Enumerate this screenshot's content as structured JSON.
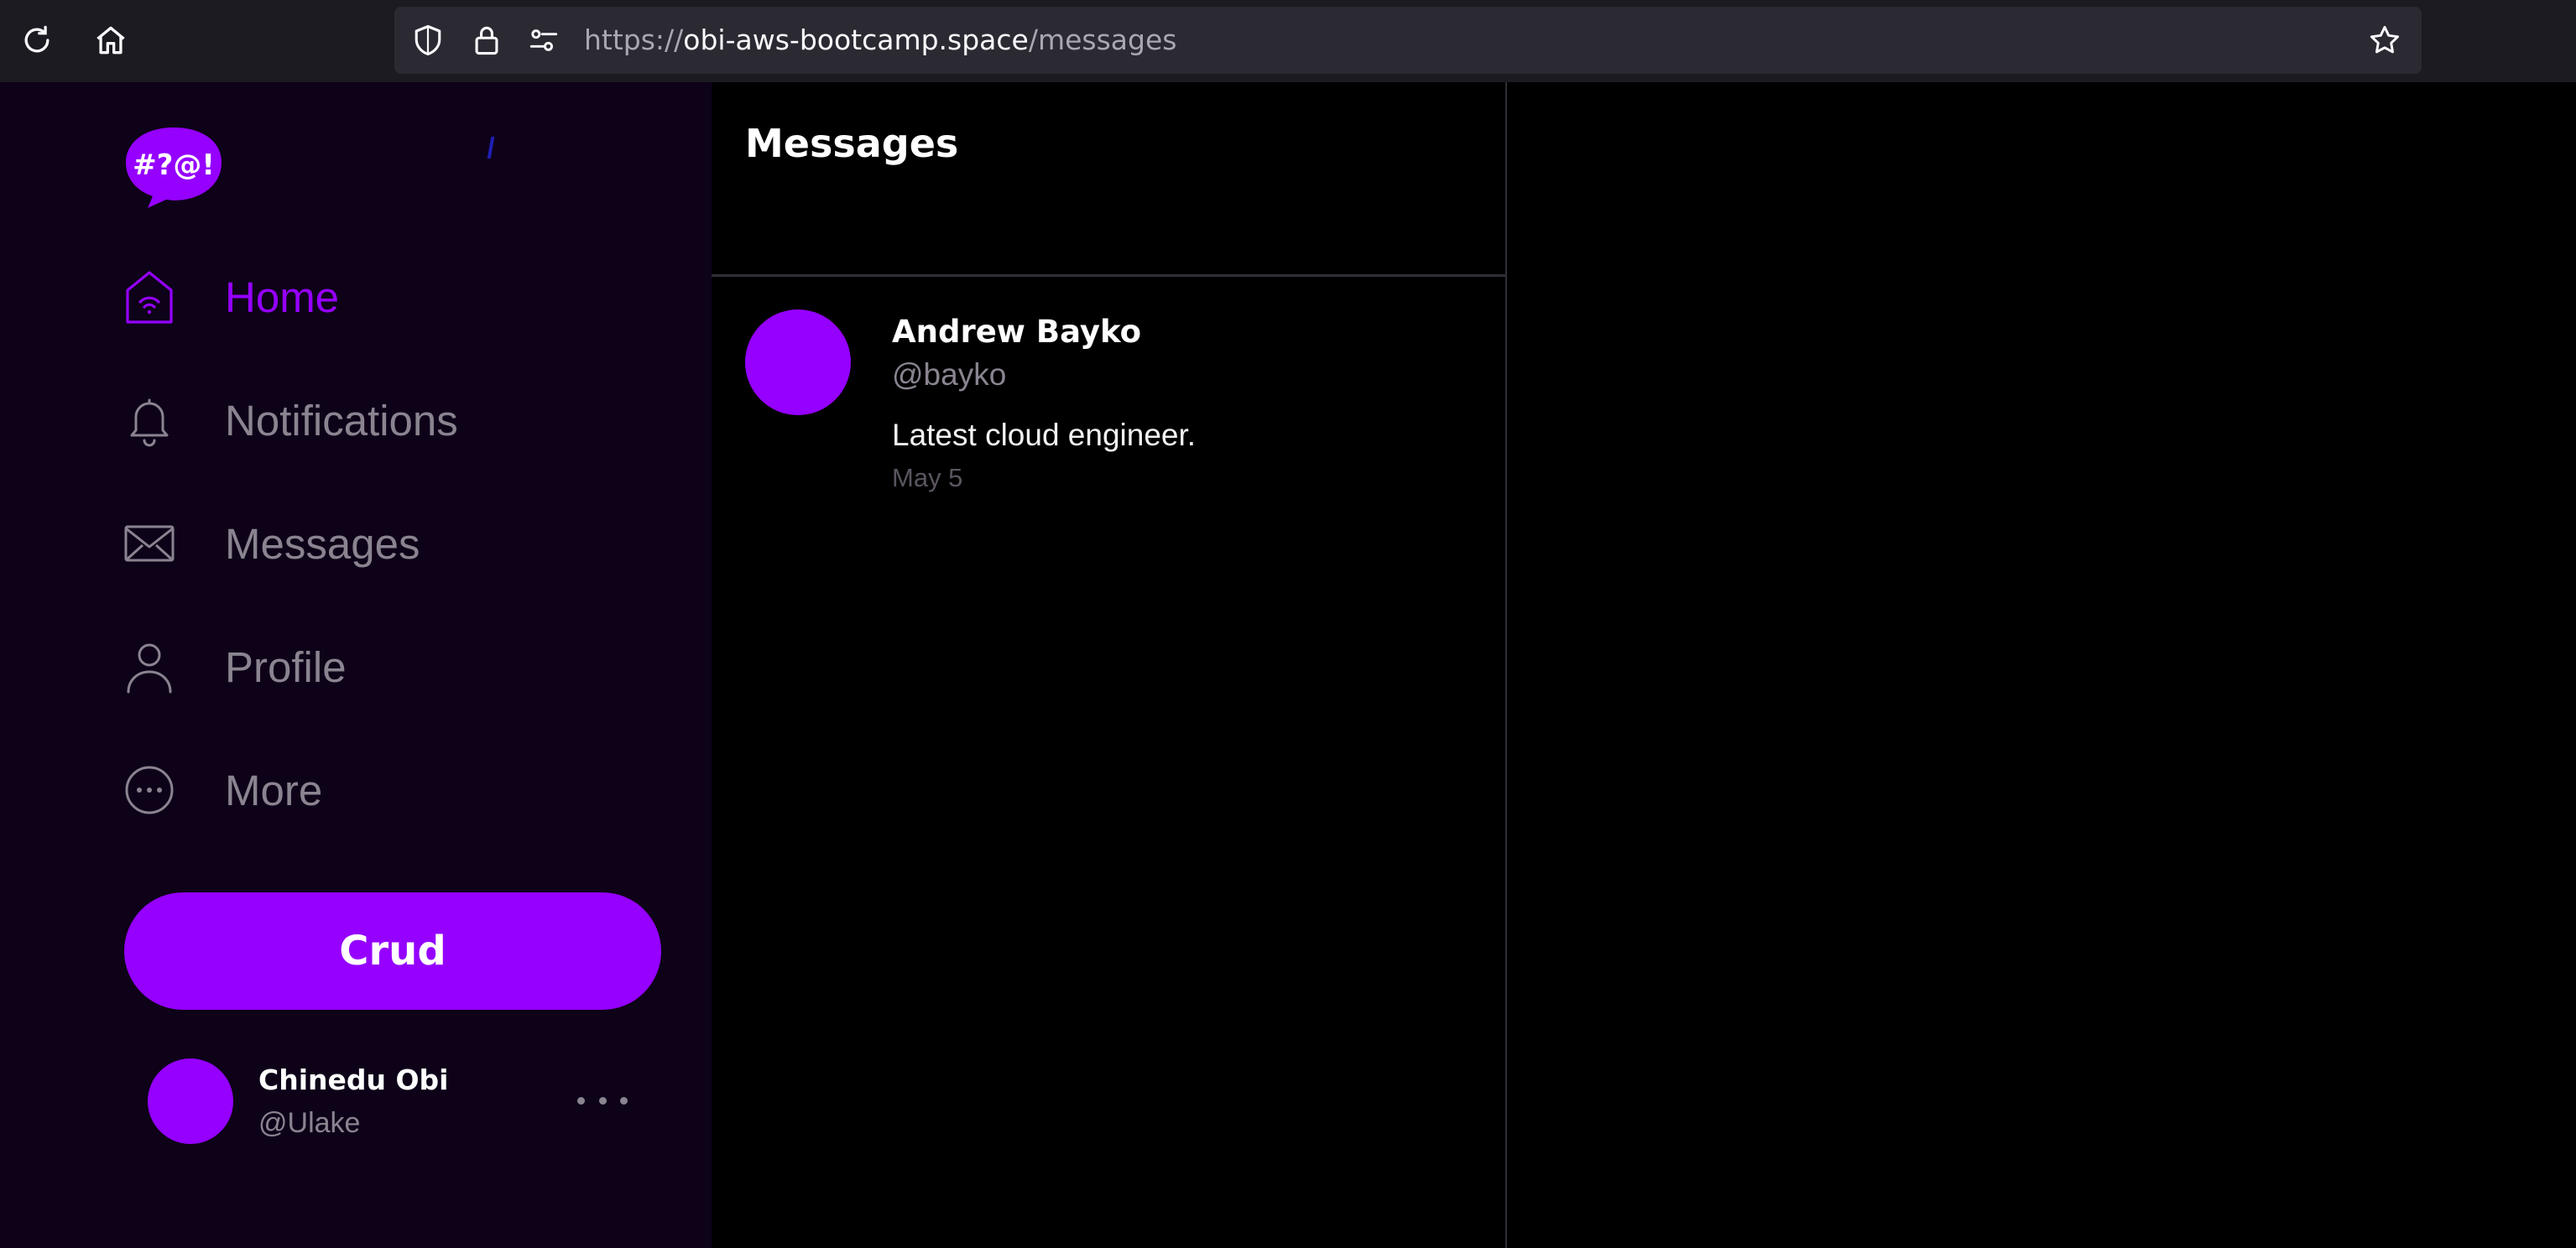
{
  "browser": {
    "url_scheme": "https://",
    "url_host": "obi-aws-bootcamp.space",
    "url_path": "/messages",
    "icons": [
      "reload-icon",
      "home-icon",
      "shield-icon",
      "lock-icon",
      "permissions-icon",
      "bookmark-star-icon"
    ]
  },
  "sidebar": {
    "logo_text": "#?@!",
    "nav": [
      {
        "label": "Home",
        "icon": "home-icon",
        "active": true
      },
      {
        "label": "Notifications",
        "icon": "bell-icon",
        "active": false
      },
      {
        "label": "Messages",
        "icon": "envelope-icon",
        "active": false
      },
      {
        "label": "Profile",
        "icon": "person-icon",
        "active": false
      },
      {
        "label": "More",
        "icon": "more-circle-icon",
        "active": false
      }
    ],
    "crud_label": "Crud",
    "profile": {
      "name": "Chinedu Obi",
      "handle": "@Ulake"
    }
  },
  "messages": {
    "title": "Messages",
    "items": [
      {
        "sender": "Andrew Bayko",
        "handle": "@bayko",
        "text": "Latest cloud engineer.",
        "date": "May 5"
      }
    ]
  },
  "colors": {
    "accent": "#9500ff",
    "sidebar_bg": "#0e0219",
    "page_bg": "#000000",
    "muted_text": "#8a8490",
    "browser_bg": "#1c1b22",
    "urlbar_bg": "#2b2a33"
  }
}
